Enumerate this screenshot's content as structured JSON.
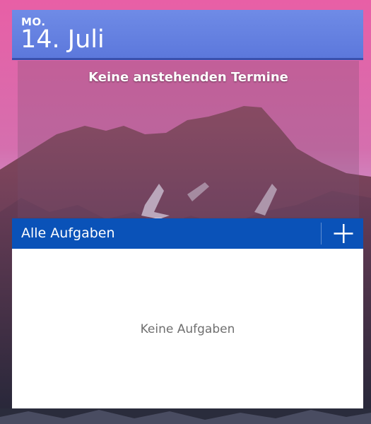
{
  "calendar": {
    "weekday": "MO.",
    "date": "14. Juli",
    "empty_message": "Keine anstehenden Termine"
  },
  "tasks": {
    "title": "Alle Aufgaben",
    "empty_message": "Keine Aufgaben",
    "add_icon": "plus-icon"
  },
  "colors": {
    "calendar_header": "#6680e0",
    "tasks_header": "#0a52b8",
    "tasks_body": "#ffffff"
  }
}
